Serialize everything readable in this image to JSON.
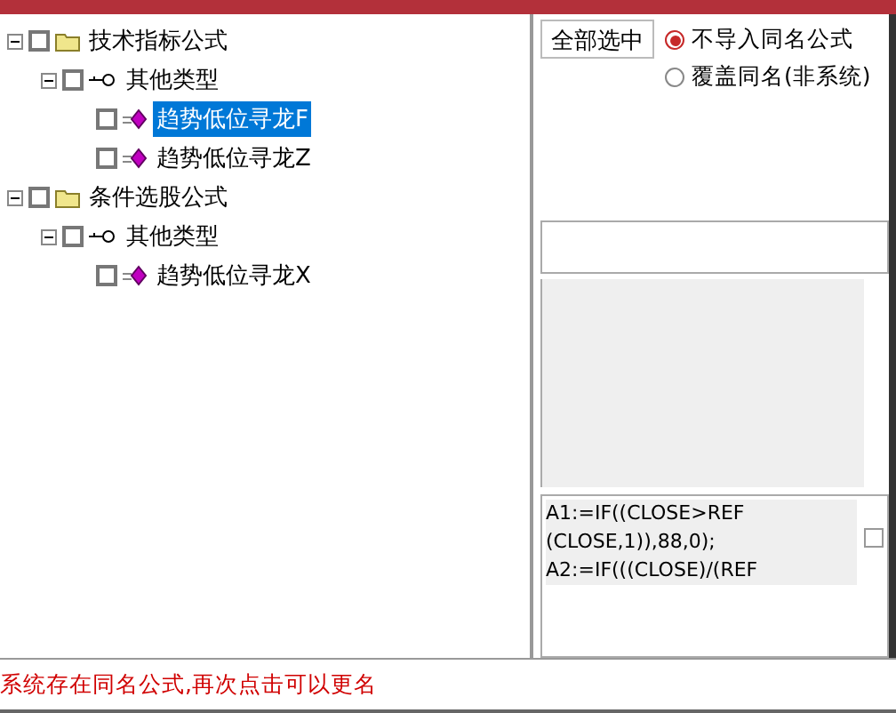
{
  "tree": [
    {
      "label": "技术指标公式",
      "kind": "folder",
      "expanded": true,
      "checked": false,
      "selected": false,
      "children": [
        {
          "label": "其他类型",
          "kind": "type",
          "expanded": true,
          "checked": false,
          "selected": false,
          "children": [
            {
              "label": "趋势低位寻龙F",
              "kind": "formula",
              "checked": false,
              "selected": true
            },
            {
              "label": "趋势低位寻龙Z",
              "kind": "formula",
              "checked": false,
              "selected": false
            }
          ]
        }
      ]
    },
    {
      "label": "条件选股公式",
      "kind": "folder",
      "expanded": true,
      "checked": false,
      "selected": false,
      "children": [
        {
          "label": "其他类型",
          "kind": "type",
          "expanded": true,
          "checked": false,
          "selected": false,
          "children": [
            {
              "label": "趋势低位寻龙X",
              "kind": "formula",
              "checked": false,
              "selected": false
            }
          ]
        }
      ]
    }
  ],
  "select_all_button": "全部选中",
  "options": [
    {
      "label": "不导入同名公式",
      "selected": true
    },
    {
      "label": "覆盖同名(非系统)",
      "selected": false
    }
  ],
  "formula_preview": {
    "text": [
      "A1:=IF((CLOSE>REF",
      "(CLOSE,1)),88,0);",
      "A2:=IF(((CLOSE)/(REF"
    ],
    "checked": false
  },
  "status": "系统存在同名公式,再次点击可以更名"
}
